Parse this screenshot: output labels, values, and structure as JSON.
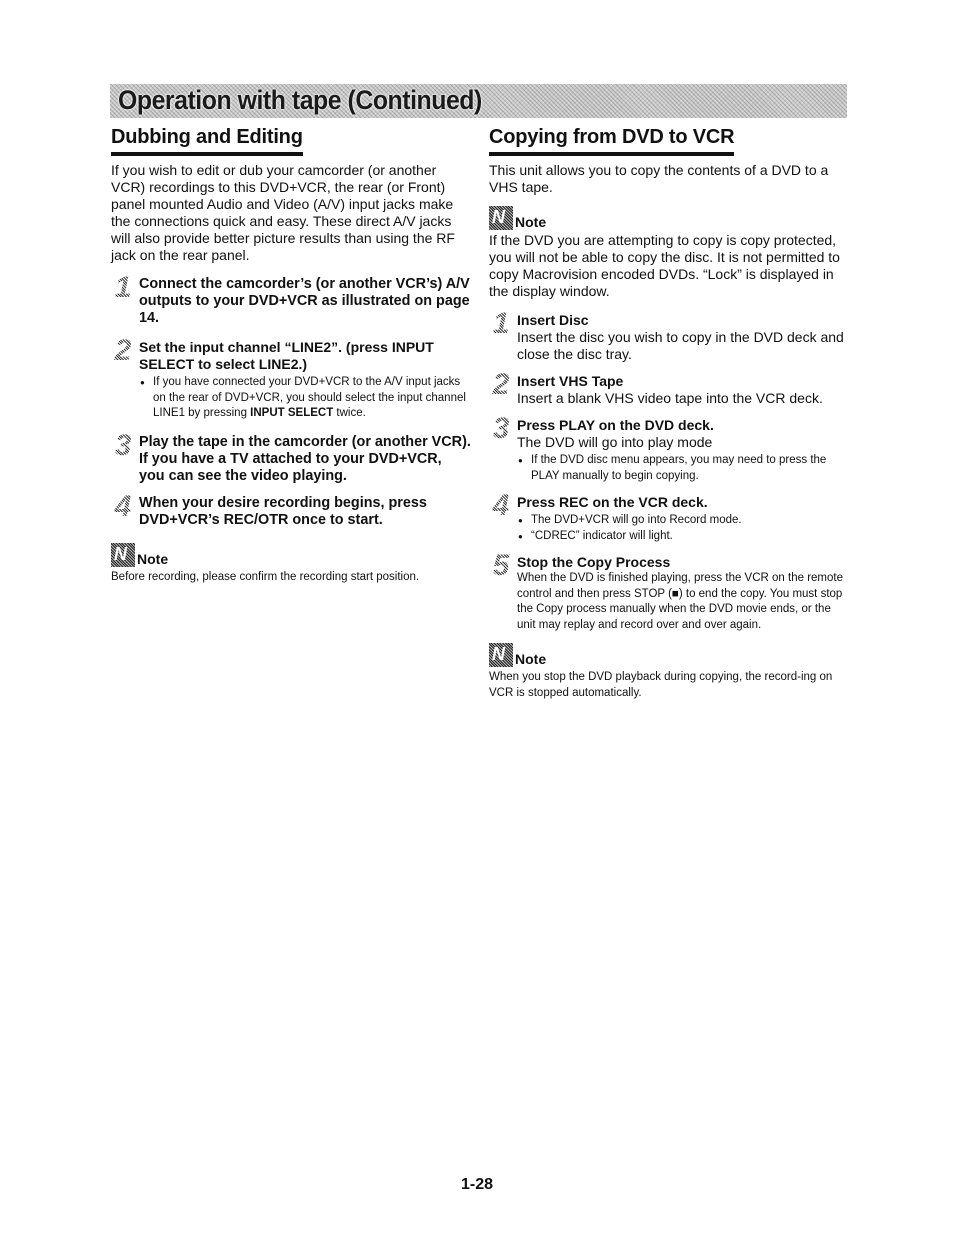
{
  "banner": {
    "title": "Operation with tape (Continued)"
  },
  "left": {
    "title": "Dubbing and Editing",
    "intro": "If you wish to edit or dub your camcorder (or another VCR) recordings to this DVD+VCR, the rear (or Front) panel mounted Audio and Video (A/V) input jacks make the connections quick and easy. These direct A/V jacks will also provide better picture results than using the RF jack on the rear panel.",
    "steps": [
      {
        "number": "1",
        "title": "Connect the camcorder’s (or another VCR’s) A/V outputs to your DVD+VCR as illustrated on page 14."
      },
      {
        "number": "2",
        "title": "Set the input channel “LINE2”. (press INPUT SELECT to select LINE2.)",
        "bullets": [
          {
            "pre": "If you have connected your DVD+VCR to the A/V input jacks on the rear of DVD+VCR, you should select the input channel LINE1 by pressing ",
            "bold": "INPUT SELECT",
            "post": " twice."
          }
        ]
      },
      {
        "number": "3",
        "title": "Play the tape in the camcorder (or another VCR). If you have a TV attached to your DVD+VCR, you can see the video playing."
      },
      {
        "number": "4",
        "title": "When your desire recording begins, press DVD+VCR’s REC/OTR once to start."
      }
    ],
    "note": {
      "icon": "note-icon",
      "label": "Note",
      "text": "Before recording, please confirm the recording start position."
    }
  },
  "right": {
    "title": "Copying from DVD to VCR",
    "intro": "This unit allows you to copy the contents of a DVD to a VHS tape.",
    "note1": {
      "icon": "note-icon",
      "label": "Note",
      "text": "If the DVD you are attempting to copy is copy protected, you will not be able to copy the disc. It is not permitted to copy Macrovision encoded DVDs. “Lock” is displayed in the display window."
    },
    "steps": [
      {
        "number": "1",
        "title": "Insert Disc",
        "body": "Insert the disc you wish to copy in the DVD deck and close the disc tray."
      },
      {
        "number": "2",
        "title": "Insert VHS Tape",
        "body": "Insert a blank VHS video tape into the VCR deck."
      },
      {
        "number": "3",
        "title": "Press PLAY on the DVD deck.",
        "body": "The DVD will go into play mode",
        "bullets": [
          "If the DVD disc menu appears, you may need to press the PLAY manually to begin copying."
        ]
      },
      {
        "number": "4",
        "title": "Press REC on the VCR deck.",
        "bullets": [
          "The DVD+VCR will go into Record mode.",
          "“CDREC” indicator will light."
        ]
      },
      {
        "number": "5",
        "title": "Stop the Copy Process",
        "body": "When the DVD is finished playing, press the VCR on the remote control and then press STOP (■) to end the copy. You must stop the Copy process manually when the DVD movie ends, or the unit may replay and record over and over again."
      }
    ],
    "note2": {
      "icon": "note-icon",
      "label": "Note",
      "text": "When you stop the DVD playback during copying, the record-ing on VCR is stopped automatically."
    }
  },
  "footer": {
    "page_number": "1-28"
  }
}
